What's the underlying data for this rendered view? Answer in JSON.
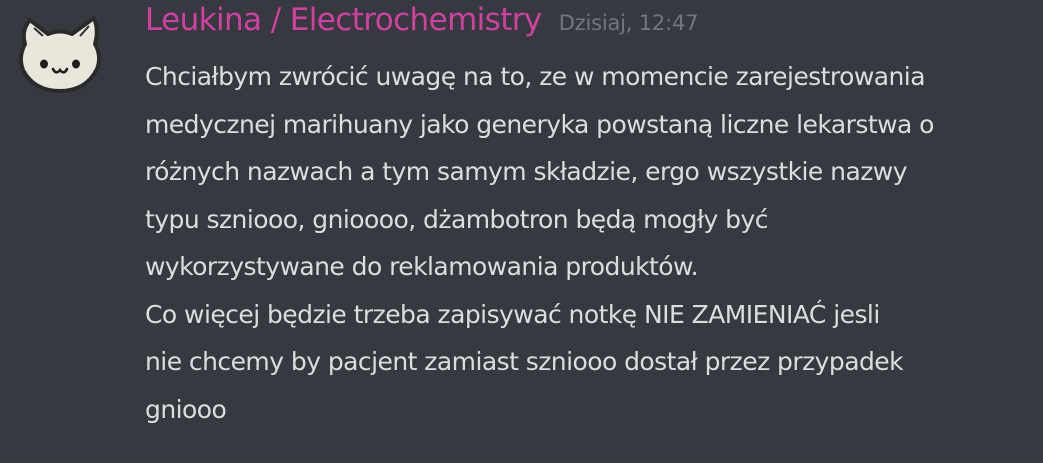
{
  "message": {
    "author": "Leukina / Electrochemistry",
    "timestamp": "Dzisiaj, 12:47",
    "author_color": "#d13fa0",
    "avatar_icon": "cat-face-icon",
    "paragraphs": [
      {
        "lines": [
          "Chciałbym zwrócić uwagę na to, ze w momencie zarejestrowania",
          "medycznej marihuany jako generyka powstaną liczne lekarstwa o",
          "różnych nazwach a tym samym składzie, ergo wszystkie nazwy",
          "typu szniooo, gnioooo, dżambotron będą mogły być",
          "wykorzystywane do reklamowania produktów."
        ]
      },
      {
        "lines": [
          "Co więcej będzie trzeba zapisywać notkę NIE ZAMIENIAĆ jesli",
          "nie chcemy by pacjent zamiast szniooo dostał przez przypadek",
          "gniooo"
        ]
      }
    ]
  },
  "colors": {
    "background": "#36393f",
    "text": "#dcddde",
    "timestamp": "#72767d"
  }
}
